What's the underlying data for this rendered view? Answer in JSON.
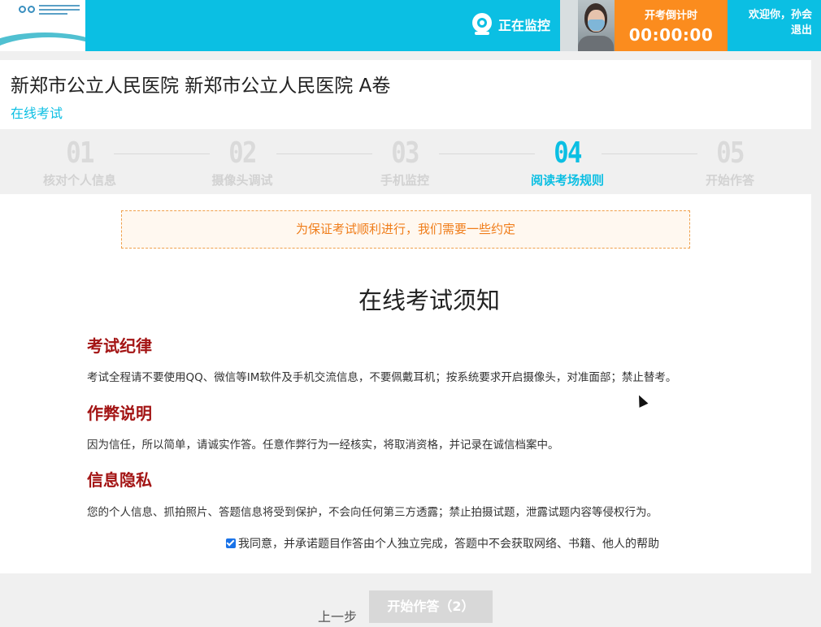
{
  "header": {
    "logo_icon": "hospital-logo",
    "monitor_label": "正在监控",
    "monitor_icon": "webcam-icon",
    "countdown_label": "开考倒计时",
    "countdown_time": "00:00:00",
    "welcome": "欢迎你，孙会",
    "logout": "退出",
    "colors": {
      "primary": "#0bbfe3",
      "countdown": "#fb8c1e"
    }
  },
  "exam": {
    "title": "新郑市公立人民医院 新郑市公立人民医院 A卷",
    "subtitle": "在线考试"
  },
  "steps": [
    {
      "num": "01",
      "name": "核对个人信息",
      "active": false
    },
    {
      "num": "02",
      "name": "摄像头调试",
      "active": false
    },
    {
      "num": "03",
      "name": "手机监控",
      "active": false
    },
    {
      "num": "04",
      "name": "阅读考场规则",
      "active": true
    },
    {
      "num": "05",
      "name": "开始作答",
      "active": false
    }
  ],
  "notice": "为保证考试顺利进行，我们需要一些约定",
  "rules": {
    "title": "在线考试须知",
    "sections": [
      {
        "heading": "考试纪律",
        "text": "考试全程请不要使用QQ、微信等IM软件及手机交流信息，不要佩戴耳机；按系统要求开启摄像头，对准面部；禁止替考。"
      },
      {
        "heading": "作弊说明",
        "text": "因为信任，所以简单，请诚实作答。任意作弊行为一经核实，将取消资格，并记录在诚信档案中。"
      },
      {
        "heading": "信息隐私",
        "text": "您的个人信息、抓拍照片、答题信息将受到保护，不会向任何第三方透露；禁止拍摄试题，泄露试题内容等侵权行为。"
      }
    ],
    "agree_text": "我同意，并承诺题目作答由个人独立完成，答题中不会获取网络、书籍、他人的帮助",
    "agree_checked": true
  },
  "footer": {
    "prev_label": "上一步",
    "start_label": "开始作答（2）"
  }
}
